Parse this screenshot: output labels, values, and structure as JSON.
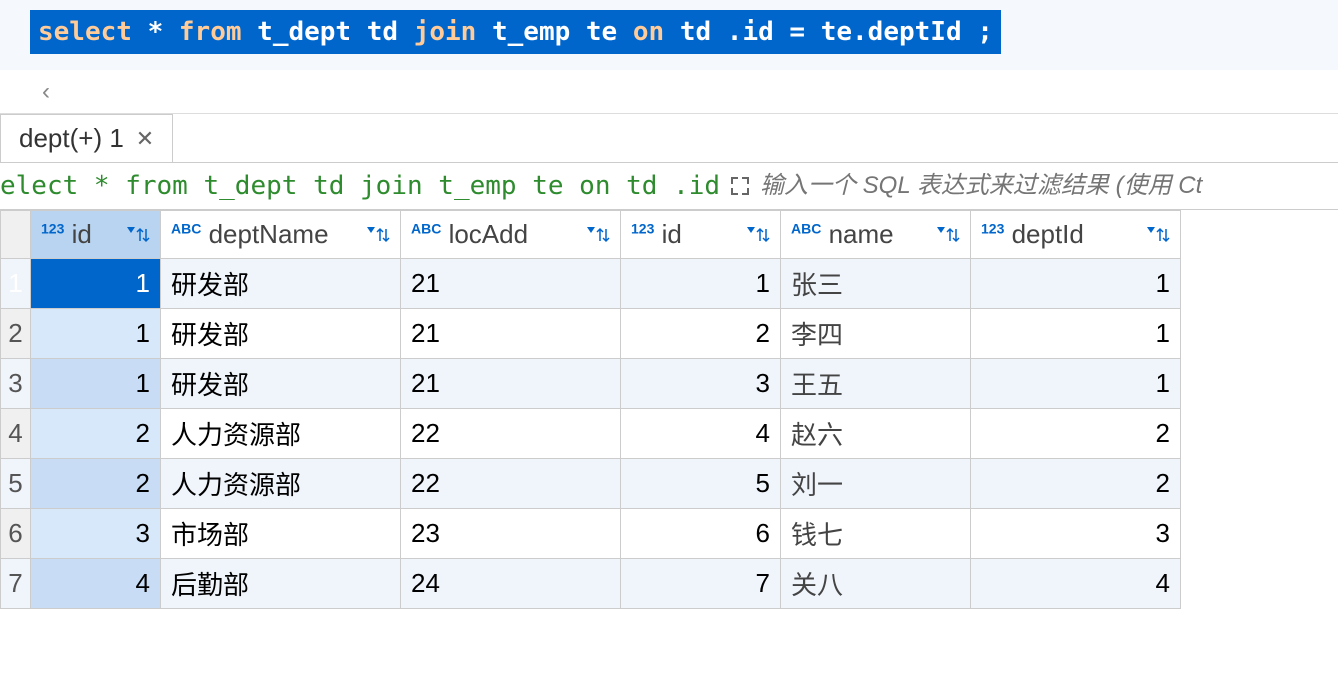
{
  "sql_editor": {
    "tokens": [
      {
        "t": "select",
        "kw": true
      },
      {
        "t": " * ",
        "kw": false
      },
      {
        "t": "from",
        "kw": true
      },
      {
        "t": " t_dept td ",
        "kw": false
      },
      {
        "t": "join",
        "kw": true
      },
      {
        "t": "  t_emp te ",
        "kw": false
      },
      {
        "t": "on",
        "kw": true
      },
      {
        "t": " td .id = te.deptId ;",
        "kw": false
      }
    ]
  },
  "tab": {
    "label": "dept(+) 1"
  },
  "query_bar": {
    "query_text": "elect * from t_dept td join t_emp te on td .id = te.d",
    "filter_placeholder": "输入一个 SQL 表达式来过滤结果 (使用 Ct"
  },
  "columns": [
    {
      "type_icon": "123",
      "name": "id",
      "cls": "col-id1",
      "numeric": true,
      "selected": true
    },
    {
      "type_icon": "ABC",
      "name": "deptName",
      "cls": "col-deptname",
      "numeric": false
    },
    {
      "type_icon": "ABC",
      "name": "locAdd",
      "cls": "col-locadd",
      "numeric": false
    },
    {
      "type_icon": "123",
      "name": "id",
      "cls": "col-id2",
      "numeric": true
    },
    {
      "type_icon": "ABC",
      "name": "name",
      "cls": "col-name",
      "numeric": false
    },
    {
      "type_icon": "123",
      "name": "deptId",
      "cls": "col-deptid",
      "numeric": true
    }
  ],
  "rows": [
    {
      "n": "1",
      "selected": true,
      "cells": [
        "1",
        "研发部",
        "21",
        "1",
        "张三",
        "1"
      ]
    },
    {
      "n": "2",
      "cells": [
        "1",
        "研发部",
        "21",
        "2",
        "李四",
        "1"
      ]
    },
    {
      "n": "3",
      "cells": [
        "1",
        "研发部",
        "21",
        "3",
        "王五",
        "1"
      ]
    },
    {
      "n": "4",
      "cells": [
        "2",
        "人力资源部",
        "22",
        "4",
        "赵六",
        "2"
      ]
    },
    {
      "n": "5",
      "cells": [
        "2",
        "人力资源部",
        "22",
        "5",
        "刘一",
        "2"
      ]
    },
    {
      "n": "6",
      "cells": [
        "3",
        "市场部",
        "23",
        "6",
        "钱七",
        "3"
      ]
    },
    {
      "n": "7",
      "cells": [
        "4",
        "后勤部",
        "24",
        "7",
        "关八",
        "4"
      ]
    }
  ]
}
